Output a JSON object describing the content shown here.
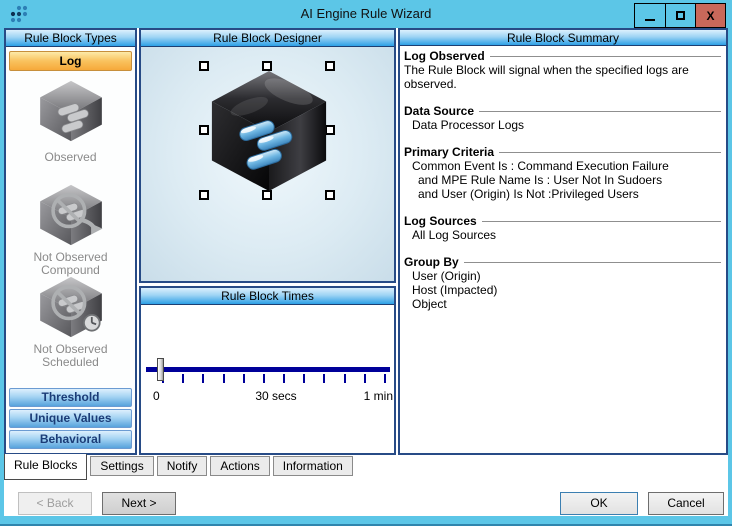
{
  "window": {
    "title": "AI Engine Rule Wizard",
    "controls": {
      "minimize": "minimize",
      "maximize": "maximize",
      "close_glyph": "X"
    }
  },
  "colors": {
    "titlebar": "#5cc6e7",
    "close_button": "#c9685a",
    "panel_border": "#274b86",
    "header_gradient_bottom": "#2da0e6",
    "log_button_orange": "#f6a93a",
    "slider_track": "#000099"
  },
  "rule_block_types": {
    "header": "Rule Block Types",
    "selected_type": "Log",
    "log_items": [
      {
        "icon": "cube-observed-icon",
        "label1": "Observed",
        "label2": ""
      },
      {
        "icon": "cube-not-observed-compound-icon",
        "label1": "Not Observed",
        "label2": "Compound"
      },
      {
        "icon": "cube-not-observed-scheduled-icon",
        "label1": "Not Observed",
        "label2": "Scheduled"
      }
    ],
    "other_types": [
      "Threshold",
      "Unique Values",
      "Behavioral"
    ]
  },
  "designer": {
    "header": "Rule Block Designer",
    "selected_block": "Log Observed cube"
  },
  "times": {
    "header": "Rule Block Times",
    "slider_value": "0",
    "labels": [
      "0",
      "30 secs",
      "1 min"
    ]
  },
  "summary": {
    "header": "Rule Block Summary",
    "sections": [
      {
        "heading": "Log Observed",
        "lines": [
          "The Rule Block will signal when the specified logs are observed."
        ]
      },
      {
        "heading": "Data Source",
        "lines": [
          "Data Processor Logs"
        ]
      },
      {
        "heading": "Primary Criteria",
        "lines": [
          "Common Event Is : Command Execution Failure",
          "and MPE Rule Name Is : User Not In Sudoers",
          "and User (Origin) Is Not :Privileged Users"
        ]
      },
      {
        "heading": "Log Sources",
        "lines": [
          "All Log Sources"
        ]
      },
      {
        "heading": "Group By",
        "lines": [
          "User (Origin)",
          "Host (Impacted)",
          "Object"
        ]
      }
    ]
  },
  "tabs": [
    "Rule Blocks",
    "Settings",
    "Notify",
    "Actions",
    "Information"
  ],
  "active_tab": "Rule Blocks",
  "buttons": {
    "back": "< Back",
    "next": "Next >",
    "ok": "OK",
    "cancel": "Cancel"
  }
}
